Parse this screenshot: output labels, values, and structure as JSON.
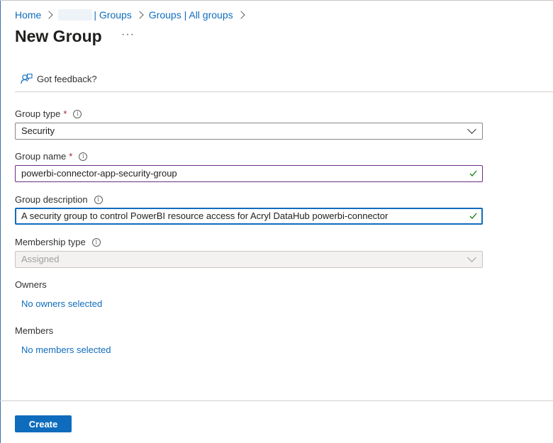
{
  "breadcrumb": {
    "items": [
      "Home",
      "| Groups",
      "Groups | All groups"
    ]
  },
  "page": {
    "title": "New Group",
    "more_label": "···"
  },
  "toolbar": {
    "feedback_label": "Got feedback?"
  },
  "form": {
    "group_type": {
      "label": "Group type",
      "required": "*",
      "value": "Security"
    },
    "group_name": {
      "label": "Group name",
      "required": "*",
      "value": "powerbi-connector-app-security-group"
    },
    "group_description": {
      "label": "Group description",
      "value": "A security group to control PowerBI resource access for Acryl DataHub powerbi-connector"
    },
    "membership_type": {
      "label": "Membership type",
      "value": "Assigned"
    },
    "owners": {
      "label": "Owners",
      "link": "No owners selected"
    },
    "members": {
      "label": "Members",
      "link": "No members selected"
    }
  },
  "footer": {
    "create_label": "Create"
  },
  "colors": {
    "link": "#0f6cbd",
    "primary_button": "#0f6cbd",
    "required": "#a4262c",
    "valid_check": "#107c10"
  }
}
